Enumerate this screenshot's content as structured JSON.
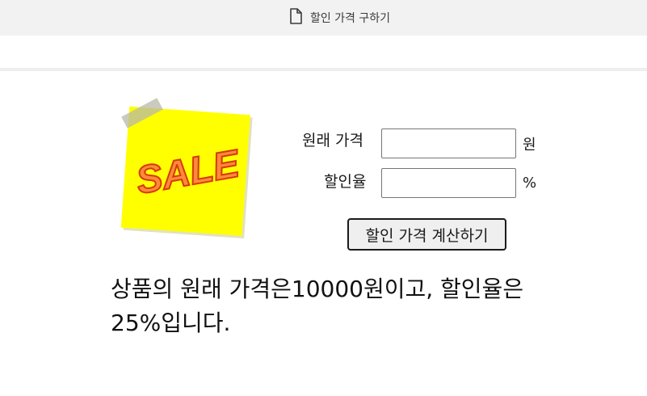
{
  "tab": {
    "title": "할인 가격 구하기",
    "icon": "document-icon"
  },
  "image": {
    "text": "SALE",
    "note_color": "#ffff00",
    "text_color": "#e84a12"
  },
  "form": {
    "price_label": "원래 가격",
    "price_value": "",
    "price_unit": "원",
    "rate_label": "할인율",
    "rate_value": "",
    "rate_unit": "%"
  },
  "button": {
    "label": "할인 가격 계산하기"
  },
  "result": {
    "text": "상품의 원래 가격은10000원이고, 할인율은 25%입니다."
  }
}
